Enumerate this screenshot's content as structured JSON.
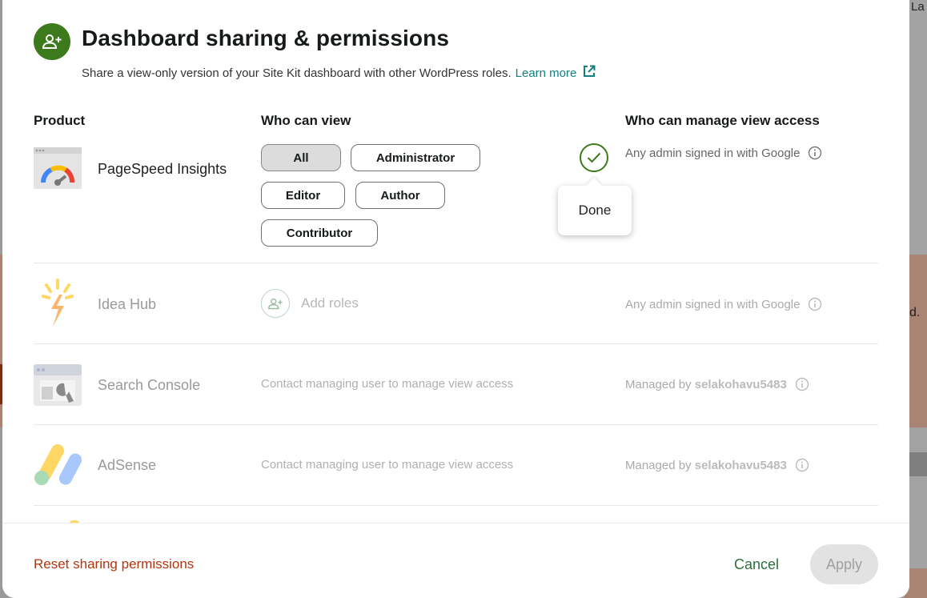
{
  "dialog": {
    "title": "Dashboard sharing & permissions",
    "subtitle": "Share a view-only version of your Site Kit dashboard with other WordPress roles.",
    "learn_more": "Learn more",
    "icon": "add-person-icon",
    "accent_color": "#3c7a1b"
  },
  "columns": {
    "product": "Product",
    "who_can_view": "Who can view",
    "who_can_manage": "Who can manage view access"
  },
  "rows": [
    {
      "product": "PageSpeed Insights",
      "icon": "pagespeed-gauge-icon",
      "roles": [
        {
          "label": "All",
          "selected": true
        },
        {
          "label": "Administrator",
          "selected": false
        },
        {
          "label": "Editor",
          "selected": false
        },
        {
          "label": "Author",
          "selected": false
        },
        {
          "label": "Contributor",
          "selected": false
        }
      ],
      "confirm_tooltip": "Done",
      "manage": "Any admin signed in with Google"
    },
    {
      "product": "Idea Hub",
      "icon": "idea-hub-icon",
      "add_roles": "Add roles",
      "manage": "Any admin signed in with Google"
    },
    {
      "product": "Search Console",
      "icon": "search-console-icon",
      "contact": "Contact managing user to manage view access",
      "managed_by_prefix": "Managed by",
      "managed_by_user": "selakohavu5483"
    },
    {
      "product": "AdSense",
      "icon": "adsense-icon",
      "contact": "Contact managing user to manage view access",
      "managed_by_prefix": "Managed by",
      "managed_by_user": "selakohavu5483"
    }
  ],
  "footer": {
    "reset": "Reset sharing permissions",
    "cancel": "Cancel",
    "apply": "Apply"
  },
  "background": {
    "fragment_top": "La",
    "fragment_mid": "d."
  },
  "colors": {
    "reset_link": "#b3360f",
    "cancel_link": "#2a6e3a",
    "learn_more": "#108080"
  }
}
